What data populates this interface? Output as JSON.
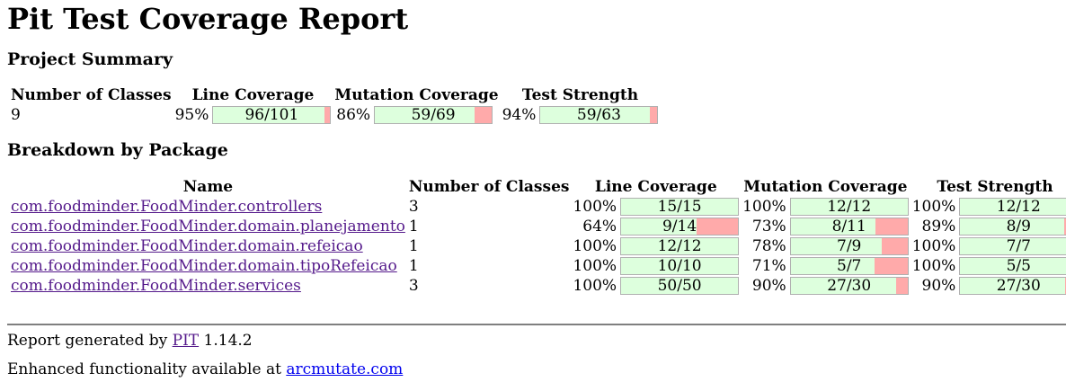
{
  "title": "Pit Test Coverage Report",
  "summary": {
    "heading": "Project Summary",
    "headers": {
      "classes": "Number of Classes",
      "line": "Line Coverage",
      "mutation": "Mutation Coverage",
      "strength": "Test Strength"
    },
    "classes": "9",
    "line": {
      "pct": "95%",
      "label": "96/101",
      "fraction": 0.9505
    },
    "mutation": {
      "pct": "86%",
      "label": "59/69",
      "fraction": 0.855
    },
    "strength": {
      "pct": "94%",
      "label": "59/63",
      "fraction": 0.9365
    }
  },
  "breakdown": {
    "heading": "Breakdown by Package",
    "headers": {
      "name": "Name",
      "classes": "Number of Classes",
      "line": "Line Coverage",
      "mutation": "Mutation Coverage",
      "strength": "Test Strength"
    },
    "rows": [
      {
        "name": "com.foodminder.FoodMinder.controllers",
        "classes": "3",
        "line": {
          "pct": "100%",
          "label": "15/15",
          "fraction": 1.0
        },
        "mutation": {
          "pct": "100%",
          "label": "12/12",
          "fraction": 1.0
        },
        "strength": {
          "pct": "100%",
          "label": "12/12",
          "fraction": 1.0
        }
      },
      {
        "name": "com.foodminder.FoodMinder.domain.planejamento",
        "classes": "1",
        "line": {
          "pct": "64%",
          "label": "9/14",
          "fraction": 0.643
        },
        "mutation": {
          "pct": "73%",
          "label": "8/11",
          "fraction": 0.727
        },
        "strength": {
          "pct": "89%",
          "label": "8/9",
          "fraction": 0.889
        }
      },
      {
        "name": "com.foodminder.FoodMinder.domain.refeicao",
        "classes": "1",
        "line": {
          "pct": "100%",
          "label": "12/12",
          "fraction": 1.0
        },
        "mutation": {
          "pct": "78%",
          "label": "7/9",
          "fraction": 0.778
        },
        "strength": {
          "pct": "100%",
          "label": "7/7",
          "fraction": 1.0
        }
      },
      {
        "name": "com.foodminder.FoodMinder.domain.tipoRefeicao",
        "classes": "1",
        "line": {
          "pct": "100%",
          "label": "10/10",
          "fraction": 1.0
        },
        "mutation": {
          "pct": "71%",
          "label": "5/7",
          "fraction": 0.714
        },
        "strength": {
          "pct": "100%",
          "label": "5/5",
          "fraction": 1.0
        }
      },
      {
        "name": "com.foodminder.FoodMinder.services",
        "classes": "3",
        "line": {
          "pct": "100%",
          "label": "50/50",
          "fraction": 1.0
        },
        "mutation": {
          "pct": "90%",
          "label": "27/30",
          "fraction": 0.9
        },
        "strength": {
          "pct": "90%",
          "label": "27/30",
          "fraction": 0.9
        }
      }
    ]
  },
  "footer": {
    "generated_prefix": "Report generated by",
    "pit_link": "PIT",
    "version": "1.14.2",
    "enhanced_prefix": "Enhanced functionality available at",
    "arcmutate_link": "arcmutate.com"
  },
  "colors": {
    "covered": "#ddffdd",
    "uncovered": "#ffaaaa",
    "link_visited": "#551a8b",
    "link": "#0000ee"
  }
}
